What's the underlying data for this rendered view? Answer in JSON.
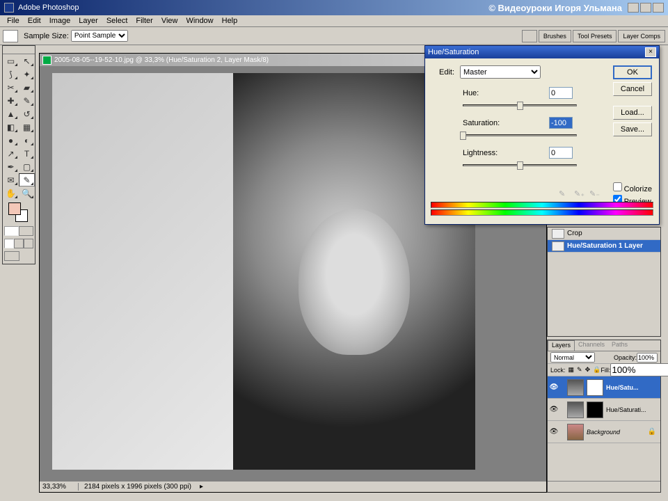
{
  "app": {
    "title": "Adobe Photoshop",
    "credit": "© Видеоуроки Игоря Ульмана"
  },
  "menu": {
    "items": [
      "File",
      "Edit",
      "Image",
      "Layer",
      "Select",
      "Filter",
      "View",
      "Window",
      "Help"
    ]
  },
  "options": {
    "sample_label": "Sample Size:",
    "sample_value": "Point Sample",
    "palettes": [
      "Brushes",
      "Tool Presets",
      "Layer Comps"
    ]
  },
  "doc": {
    "title": "2005-08-05--19-52-10.jpg @ 33,3% (Hue/Saturation 2, Layer Mask/8)",
    "zoom": "33,33%",
    "info": "2184 pixels x 1996 pixels (300 ppi)"
  },
  "huesat": {
    "title": "Hue/Saturation",
    "edit_label": "Edit:",
    "edit_value": "Master",
    "hue_label": "Hue:",
    "hue_value": "0",
    "sat_label": "Saturation:",
    "sat_value": "-100",
    "light_label": "Lightness:",
    "light_value": "0",
    "colorize": "Colorize",
    "preview": "Preview",
    "ok": "OK",
    "cancel": "Cancel",
    "load": "Load...",
    "save": "Save..."
  },
  "history": {
    "crop": "Crop",
    "hsl": "Hue/Saturation 1 Layer"
  },
  "layers": {
    "tabs": [
      "Layers",
      "Channels",
      "Paths"
    ],
    "blend": "Normal",
    "opacity_label": "Opacity:",
    "opacity_value": "100%",
    "lock_label": "Lock:",
    "fill_label": "Fill:",
    "fill_value": "100%",
    "items": [
      {
        "name": "Hue/Satu..."
      },
      {
        "name": "Hue/Saturati..."
      },
      {
        "name": "Background"
      }
    ]
  }
}
